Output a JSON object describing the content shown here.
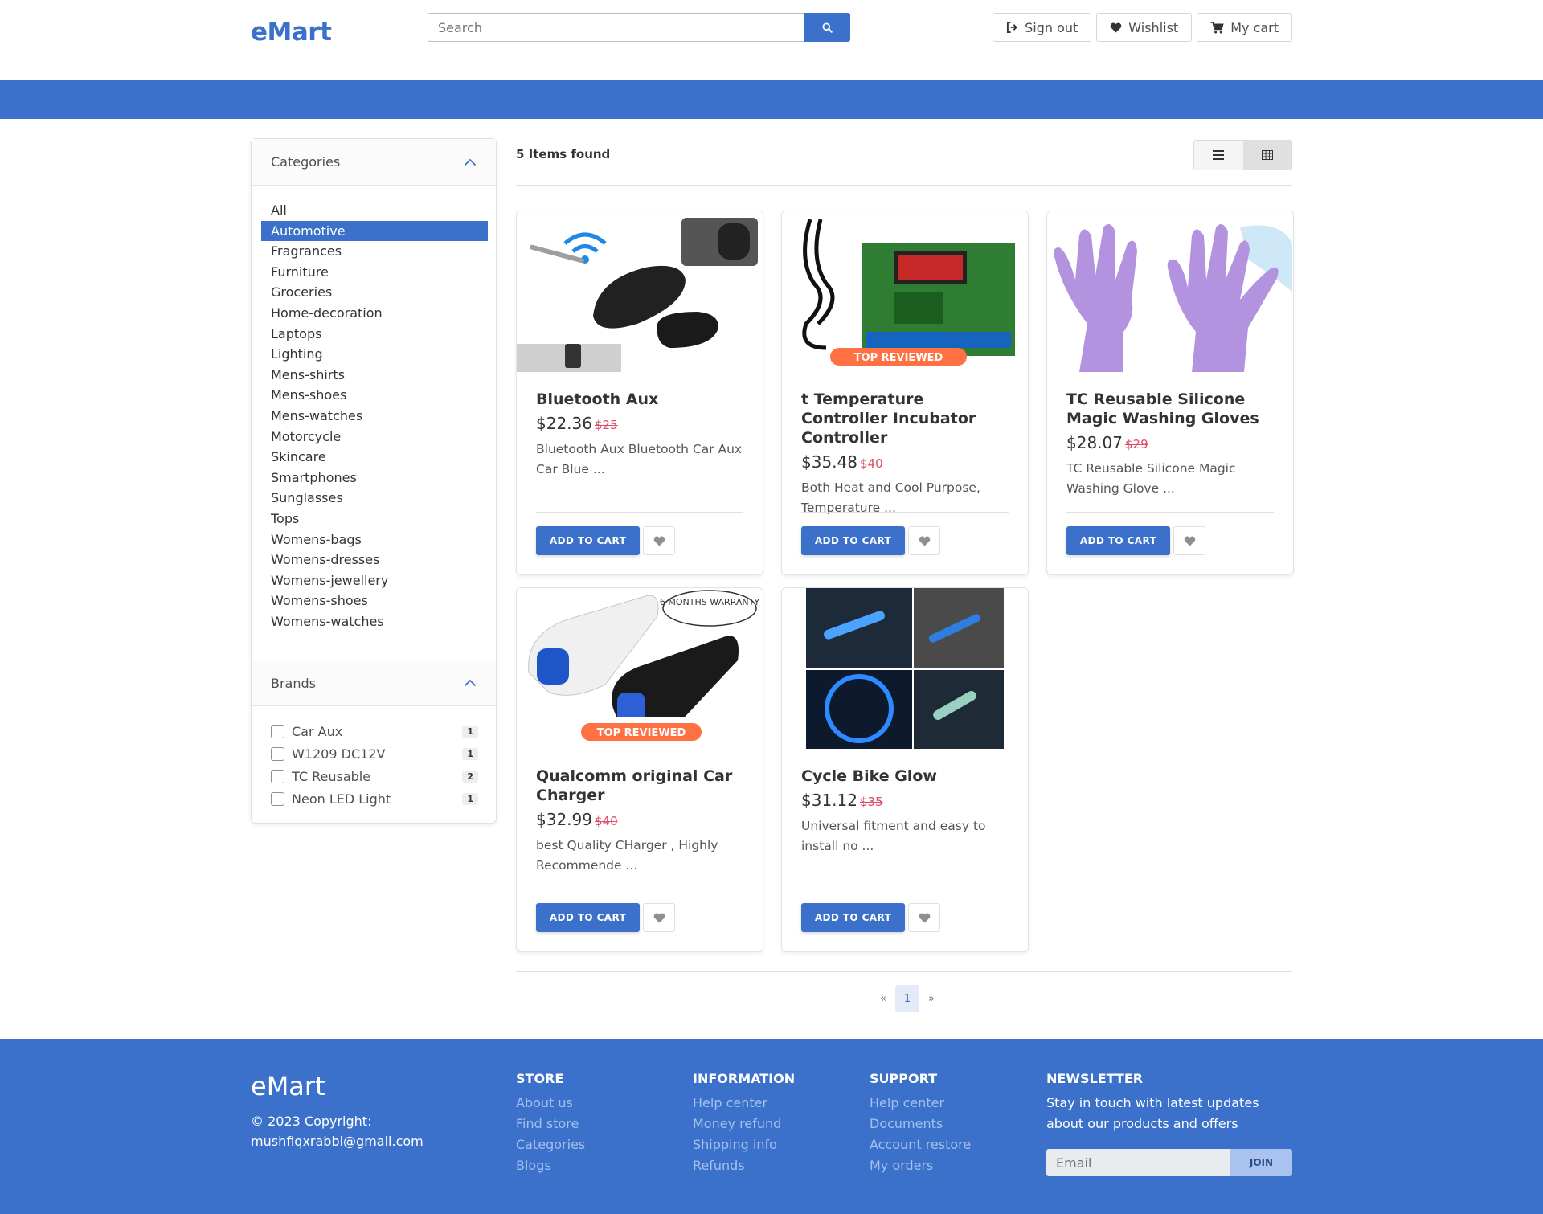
{
  "header": {
    "logo": "eMart",
    "search_placeholder": "Search",
    "sign_out": "Sign out",
    "wishlist": "Wishlist",
    "cart": "My cart"
  },
  "sidebar": {
    "categories_title": "Categories",
    "categories": [
      "All",
      "Automotive",
      "Fragrances",
      "Furniture",
      "Groceries",
      "Home-decoration",
      "Laptops",
      "Lighting",
      "Mens-shirts",
      "Mens-shoes",
      "Mens-watches",
      "Motorcycle",
      "Skincare",
      "Smartphones",
      "Sunglasses",
      "Tops",
      "Womens-bags",
      "Womens-dresses",
      "Womens-jewellery",
      "Womens-shoes",
      "Womens-watches"
    ],
    "selected_category": "Automotive",
    "brands_title": "Brands",
    "brands": [
      {
        "name": "Car Aux",
        "count": "1"
      },
      {
        "name": "W1209 DC12V",
        "count": "1"
      },
      {
        "name": "TC Reusable",
        "count": "2"
      },
      {
        "name": "Neon LED Light",
        "count": "1"
      }
    ]
  },
  "main": {
    "items_found": "5 Items found",
    "add_to_cart": "ADD TO CART",
    "products": [
      {
        "title": "Bluetooth Aux",
        "price": "$22.36",
        "old_price": "$25",
        "desc": "Bluetooth Aux Bluetooth Car Aux Car Blue ..."
      },
      {
        "title": "t Temperature Controller Incubator Controller",
        "price": "$35.48",
        "old_price": "$40",
        "desc": "Both Heat and Cool Purpose, Temperature ...",
        "image_badge": "TOP REVIEWED"
      },
      {
        "title": "TC Reusable Silicone Magic Washing Gloves",
        "price": "$28.07",
        "old_price": "$29",
        "desc": "TC Reusable Silicone Magic Washing Glove ..."
      },
      {
        "title": "Qualcomm original Car Charger",
        "price": "$32.99",
        "old_price": "$40",
        "desc": "best Quality CHarger , Highly Recommende ...",
        "image_badge": "TOP REVIEWED",
        "image_bubble": "6 MONTHS WARRANTY"
      },
      {
        "title": "Cycle Bike Glow",
        "price": "$31.12",
        "old_price": "$35",
        "desc": "Universal fitment and easy to install no ..."
      }
    ],
    "pagination": {
      "prev": "«",
      "current": "1",
      "next": "»"
    }
  },
  "footer": {
    "logo": "eMart",
    "copyright": "© 2023 Copyright: mushfiqxrabbi@gmail.com",
    "store": {
      "title": "STORE",
      "links": [
        "About us",
        "Find store",
        "Categories",
        "Blogs"
      ]
    },
    "information": {
      "title": "INFORMATION",
      "links": [
        "Help center",
        "Money refund",
        "Shipping info",
        "Refunds"
      ]
    },
    "support": {
      "title": "SUPPORT",
      "links": [
        "Help center",
        "Documents",
        "Account restore",
        "My orders"
      ]
    },
    "newsletter": {
      "title": "NEWSLETTER",
      "text": "Stay in touch with latest updates about our products and offers",
      "placeholder": "Email",
      "button": "JOIN"
    }
  },
  "colors": {
    "primary": "#3b71ca",
    "old_price": "#dc4c64",
    "footer_link": "#a5c0ec"
  }
}
